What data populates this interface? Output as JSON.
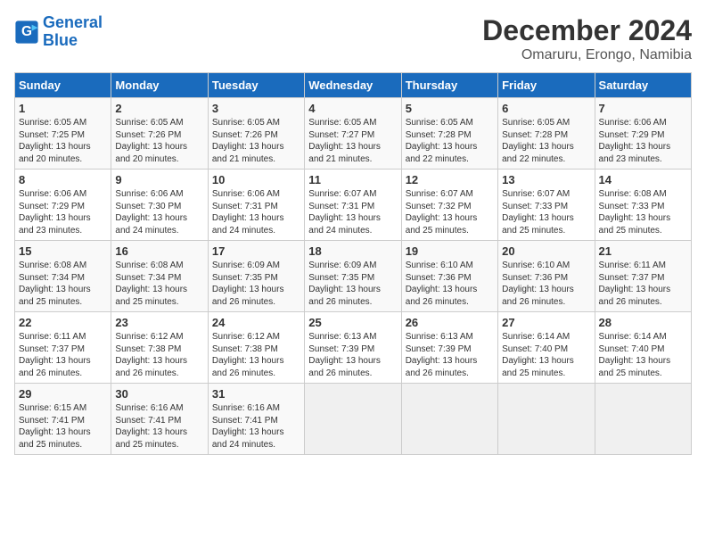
{
  "logo": {
    "line1": "General",
    "line2": "Blue"
  },
  "title": "December 2024",
  "subtitle": "Omaruru, Erongo, Namibia",
  "days_header": [
    "Sunday",
    "Monday",
    "Tuesday",
    "Wednesday",
    "Thursday",
    "Friday",
    "Saturday"
  ],
  "weeks": [
    [
      {
        "day": "1",
        "sunrise": "6:05 AM",
        "sunset": "7:25 PM",
        "daylight": "13 hours and 20 minutes."
      },
      {
        "day": "2",
        "sunrise": "6:05 AM",
        "sunset": "7:26 PM",
        "daylight": "13 hours and 20 minutes."
      },
      {
        "day": "3",
        "sunrise": "6:05 AM",
        "sunset": "7:26 PM",
        "daylight": "13 hours and 21 minutes."
      },
      {
        "day": "4",
        "sunrise": "6:05 AM",
        "sunset": "7:27 PM",
        "daylight": "13 hours and 21 minutes."
      },
      {
        "day": "5",
        "sunrise": "6:05 AM",
        "sunset": "7:28 PM",
        "daylight": "13 hours and 22 minutes."
      },
      {
        "day": "6",
        "sunrise": "6:05 AM",
        "sunset": "7:28 PM",
        "daylight": "13 hours and 22 minutes."
      },
      {
        "day": "7",
        "sunrise": "6:06 AM",
        "sunset": "7:29 PM",
        "daylight": "13 hours and 23 minutes."
      }
    ],
    [
      {
        "day": "8",
        "sunrise": "6:06 AM",
        "sunset": "7:29 PM",
        "daylight": "13 hours and 23 minutes."
      },
      {
        "day": "9",
        "sunrise": "6:06 AM",
        "sunset": "7:30 PM",
        "daylight": "13 hours and 24 minutes."
      },
      {
        "day": "10",
        "sunrise": "6:06 AM",
        "sunset": "7:31 PM",
        "daylight": "13 hours and 24 minutes."
      },
      {
        "day": "11",
        "sunrise": "6:07 AM",
        "sunset": "7:31 PM",
        "daylight": "13 hours and 24 minutes."
      },
      {
        "day": "12",
        "sunrise": "6:07 AM",
        "sunset": "7:32 PM",
        "daylight": "13 hours and 25 minutes."
      },
      {
        "day": "13",
        "sunrise": "6:07 AM",
        "sunset": "7:33 PM",
        "daylight": "13 hours and 25 minutes."
      },
      {
        "day": "14",
        "sunrise": "6:08 AM",
        "sunset": "7:33 PM",
        "daylight": "13 hours and 25 minutes."
      }
    ],
    [
      {
        "day": "15",
        "sunrise": "6:08 AM",
        "sunset": "7:34 PM",
        "daylight": "13 hours and 25 minutes."
      },
      {
        "day": "16",
        "sunrise": "6:08 AM",
        "sunset": "7:34 PM",
        "daylight": "13 hours and 25 minutes."
      },
      {
        "day": "17",
        "sunrise": "6:09 AM",
        "sunset": "7:35 PM",
        "daylight": "13 hours and 26 minutes."
      },
      {
        "day": "18",
        "sunrise": "6:09 AM",
        "sunset": "7:35 PM",
        "daylight": "13 hours and 26 minutes."
      },
      {
        "day": "19",
        "sunrise": "6:10 AM",
        "sunset": "7:36 PM",
        "daylight": "13 hours and 26 minutes."
      },
      {
        "day": "20",
        "sunrise": "6:10 AM",
        "sunset": "7:36 PM",
        "daylight": "13 hours and 26 minutes."
      },
      {
        "day": "21",
        "sunrise": "6:11 AM",
        "sunset": "7:37 PM",
        "daylight": "13 hours and 26 minutes."
      }
    ],
    [
      {
        "day": "22",
        "sunrise": "6:11 AM",
        "sunset": "7:37 PM",
        "daylight": "13 hours and 26 minutes."
      },
      {
        "day": "23",
        "sunrise": "6:12 AM",
        "sunset": "7:38 PM",
        "daylight": "13 hours and 26 minutes."
      },
      {
        "day": "24",
        "sunrise": "6:12 AM",
        "sunset": "7:38 PM",
        "daylight": "13 hours and 26 minutes."
      },
      {
        "day": "25",
        "sunrise": "6:13 AM",
        "sunset": "7:39 PM",
        "daylight": "13 hours and 26 minutes."
      },
      {
        "day": "26",
        "sunrise": "6:13 AM",
        "sunset": "7:39 PM",
        "daylight": "13 hours and 26 minutes."
      },
      {
        "day": "27",
        "sunrise": "6:14 AM",
        "sunset": "7:40 PM",
        "daylight": "13 hours and 25 minutes."
      },
      {
        "day": "28",
        "sunrise": "6:14 AM",
        "sunset": "7:40 PM",
        "daylight": "13 hours and 25 minutes."
      }
    ],
    [
      {
        "day": "29",
        "sunrise": "6:15 AM",
        "sunset": "7:41 PM",
        "daylight": "13 hours and 25 minutes."
      },
      {
        "day": "30",
        "sunrise": "6:16 AM",
        "sunset": "7:41 PM",
        "daylight": "13 hours and 25 minutes."
      },
      {
        "day": "31",
        "sunrise": "6:16 AM",
        "sunset": "7:41 PM",
        "daylight": "13 hours and 24 minutes."
      },
      null,
      null,
      null,
      null
    ]
  ]
}
